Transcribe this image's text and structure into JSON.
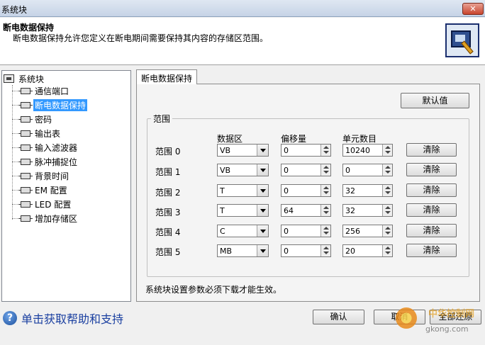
{
  "window": {
    "title": "系统块",
    "close_icon": "close-icon"
  },
  "header": {
    "title": "断电数据保持",
    "description": "断电数据保持允许您定义在断电期间需要保持其内容的存储区范围。"
  },
  "tree": {
    "root": "系统块",
    "items": [
      {
        "label": "通信端口"
      },
      {
        "label": "断电数据保持",
        "selected": true
      },
      {
        "label": "密码"
      },
      {
        "label": "输出表"
      },
      {
        "label": "输入滤波器"
      },
      {
        "label": "脉冲捕捉位"
      },
      {
        "label": "背景时间"
      },
      {
        "label": "EM 配置"
      },
      {
        "label": "LED 配置"
      },
      {
        "label": "增加存储区"
      }
    ]
  },
  "tab": {
    "label": "断电数据保持"
  },
  "panel": {
    "default_button": "默认值",
    "group_label": "范围",
    "columns": {
      "area": "数据区",
      "offset": "偏移量",
      "count": "单元数目"
    },
    "rows": [
      {
        "label": "范围 0",
        "area": "VB",
        "offset": "0",
        "count": "10240",
        "clear": "清除"
      },
      {
        "label": "范围 1",
        "area": "VB",
        "offset": "0",
        "count": "0",
        "clear": "清除"
      },
      {
        "label": "范围 2",
        "area": "T",
        "offset": "0",
        "count": "32",
        "clear": "清除"
      },
      {
        "label": "范围 3",
        "area": "T",
        "offset": "64",
        "count": "32",
        "clear": "清除"
      },
      {
        "label": "范围 4",
        "area": "C",
        "offset": "0",
        "count": "256",
        "clear": "清除"
      },
      {
        "label": "范围 5",
        "area": "MB",
        "offset": "0",
        "count": "20",
        "clear": "清除"
      }
    ],
    "note": "系统块设置参数必须下载才能生效。"
  },
  "footer": {
    "help_text": "单击获取帮助和支持",
    "ok": "确认",
    "cancel": "取消",
    "apply": "全部还原"
  },
  "watermark": {
    "text": "中华控制网",
    "url": "gkong.com"
  }
}
